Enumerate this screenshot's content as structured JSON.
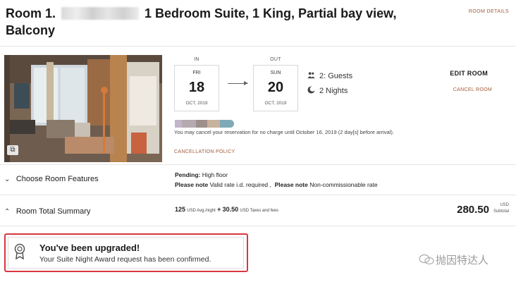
{
  "header": {
    "room_prefix": "Room  1.",
    "room_title": "1 Bedroom Suite, 1 King, Partial bay view,",
    "room_title_line2": "Balcony",
    "room_details_link": "ROOM DETAILS"
  },
  "photo": {
    "icon": "gallery-icon",
    "icon_glyph": "⧉"
  },
  "dates": {
    "in_label": "IN",
    "out_label": "OUT",
    "checkin": {
      "dow": "FRI",
      "day": "18",
      "month_year": "OCT, 2019"
    },
    "checkout": {
      "dow": "SUN",
      "day": "20",
      "month_year": "OCT, 2019"
    }
  },
  "stay": {
    "guests": "2: Guests",
    "nights": "2 Nights",
    "guests_icon": "guests-icon",
    "nights_icon": "moon-icon"
  },
  "actions": {
    "edit_room": "EDIT ROOM",
    "cancel_room": "CANCEL ROOM"
  },
  "cancellation": {
    "note": "You may cancel your reservation for no charge until October 16, 2019 (2 day[s] before arrival).",
    "policy_link": "CANCELLATION POLICY"
  },
  "features": {
    "title": "Choose Room Features",
    "pending_label": "Pending:",
    "pending_value": "High floor",
    "note_label_1": "Please note",
    "note_value_1": "Valid rate i.d. required ,",
    "note_label_2": "Please note",
    "note_value_2": "Non-commissionable rate"
  },
  "summary": {
    "title": "Room Total Summary",
    "nightly_amount": "125",
    "nightly_unit": "USD Avg./night",
    "plus": "+",
    "taxes_amount": "30.50",
    "taxes_unit": "USD Taxes and fees",
    "total": "280.50",
    "total_currency": "USD",
    "total_label": "Subtotal"
  },
  "upgrade": {
    "title": "You've been upgraded!",
    "message": "Your Suite Night Award request has been confirmed.",
    "icon": "award-ribbon-icon"
  },
  "watermark": {
    "text": "抛因特达人",
    "icon": "wechat-icon"
  },
  "colors": {
    "accent_link": "#a25b3a",
    "highlight_border": "#d9373f",
    "divider": "#e5e5e5"
  }
}
